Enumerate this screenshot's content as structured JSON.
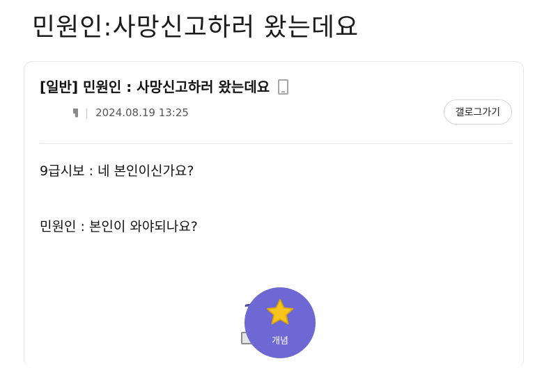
{
  "page": {
    "headline": "민원인:사망신고하러 왔는데요"
  },
  "post": {
    "title": "[일반] 민원인 : 사망신고하러 왔는데요",
    "date": "2024.08.19 13:25",
    "gallery_button_label": "갤로그가기",
    "content": [
      "9급시보 : 네 본인이신가요?",
      "민원인 : 본인이 와야되나요?"
    ]
  },
  "votes": {
    "recommend_count": "17",
    "fixed_count": "4",
    "concept_label": "개념"
  },
  "colors": {
    "accent": "#6d68d4",
    "count_text": "#4b4fa3",
    "star": "#f7c51e"
  },
  "icons": {
    "mobile": "phone-icon",
    "author": "author-badge-icon",
    "fixed": "fixed-post-icon",
    "concept": "star-icon"
  }
}
